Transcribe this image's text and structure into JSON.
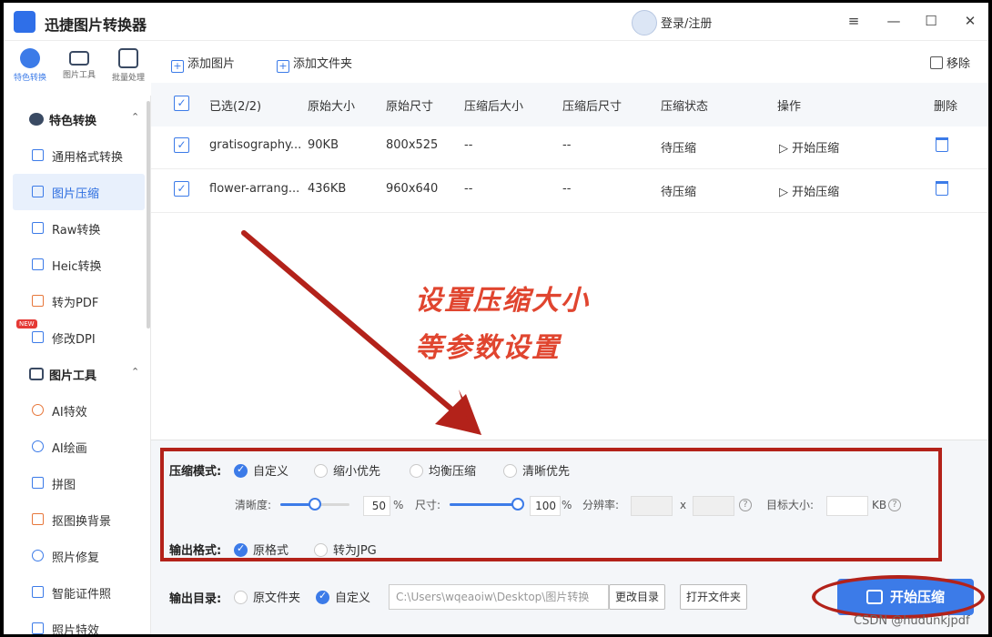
{
  "app": {
    "title": "迅捷图片转换器",
    "login": "登录/注册"
  },
  "window_controls": {
    "menu": "≡",
    "minimize": "—",
    "maximize": "☐",
    "close": "✕"
  },
  "rail": [
    {
      "label": "特色转换",
      "active": true
    },
    {
      "label": "图片工具",
      "active": false
    },
    {
      "label": "批量处理",
      "active": false
    }
  ],
  "sidebar": {
    "group1": {
      "label": "特色转换",
      "chevron": "⌃"
    },
    "group1_items": [
      "通用格式转换",
      "图片压缩",
      "Raw转换",
      "Heic转换",
      "转为PDF",
      "修改DPI"
    ],
    "new_badge": "NEW",
    "group2": {
      "label": "图片工具",
      "chevron": "⌃"
    },
    "group2_items": [
      "AI特效",
      "AI绘画",
      "拼图",
      "抠图换背景",
      "照片修复",
      "智能证件照",
      "照片特效"
    ]
  },
  "toolbar": {
    "add_image": "添加图片",
    "add_folder": "添加文件夹",
    "remove": "移除"
  },
  "table": {
    "headers": [
      "已选(2/2)",
      "原始大小",
      "原始尺寸",
      "压缩后大小",
      "压缩后尺寸",
      "压缩状态",
      "操作",
      "删除"
    ],
    "rows": [
      {
        "name": "gratisography...",
        "size": "90KB",
        "dims": "800x525",
        "after_size": "--",
        "after_dims": "--",
        "status": "待压缩",
        "action": "▷ 开始压缩"
      },
      {
        "name": "flower-arrang...",
        "size": "436KB",
        "dims": "960x640",
        "after_size": "--",
        "after_dims": "--",
        "status": "待压缩",
        "action": "▷ 开始压缩"
      }
    ]
  },
  "annotation": {
    "line1": "设置压缩大小",
    "line2": "等参数设置",
    "color": "#e0452f"
  },
  "settings": {
    "mode_label": "压缩模式:",
    "modes": [
      "自定义",
      "缩小优先",
      "均衡压缩",
      "清晰优先"
    ],
    "clarity_label": "清晰度:",
    "clarity_value": "50",
    "clarity_fraction": 0.5,
    "percent": "%",
    "size_label": "尺寸:",
    "size_value": "100",
    "size_fraction": 1.0,
    "resolution_label": "分辨率:",
    "x": "x",
    "target_label": "目标大小:",
    "kb": "KB",
    "help": "?",
    "format_label": "输出格式:",
    "formats": [
      "原格式",
      "转为JPG"
    ],
    "dir_label": "输出目录:",
    "dirs": [
      "原文件夹",
      "自定义"
    ],
    "path": "C:\\Users\\wqeaoiw\\Desktop\\图片转换",
    "change_dir": "更改目录",
    "open_folder": "打开文件夹",
    "start": "开始压缩"
  },
  "watermark": "CSDN @hudunkjpdf",
  "colors": {
    "accent": "#3c7be8",
    "annotation_red": "#b3221a"
  }
}
